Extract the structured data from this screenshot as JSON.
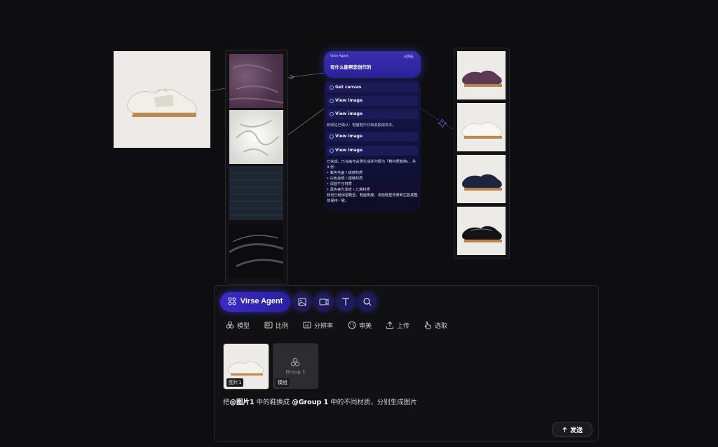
{
  "canvas": {
    "source_image_alt": "white sneaker",
    "material_images": [
      "purple suede",
      "white satin",
      "navy wool",
      "black patent leather"
    ],
    "result_images": [
      "purple sneaker",
      "white sneaker",
      "navy sneaker",
      "black sneaker"
    ]
  },
  "agent_panel": {
    "app_name": "Virse Agent",
    "status": "已完成",
    "question": "有什么能帮您创作的",
    "steps": [
      {
        "label": "Get canvas"
      },
      {
        "label": "View image"
      },
      {
        "label": "View image"
      },
      {
        "label": "View image"
      },
      {
        "label": "View image"
      }
    ],
    "note_1": "新网站已确认：鞋履鞋中仔和素颜成效本。",
    "summary_intro": "已完成，已在画布右侧生成并归组为「鞋材质替换」，共 4 张:",
    "summary_items": [
      "紫色毛面 / 绒感材质",
      "白色丝绸 / 褶皱材质",
      "深蓝牛仔材质",
      "黑色亮光漆皮 / 乙烯材质"
    ],
    "summary_outro": "我也已经保留鞋型、鞋面角度、浅色鞋垫背景和生胶底整体保持一致。"
  },
  "composer": {
    "agent_button": "Virse Agent",
    "options": [
      {
        "icon": "model-icon",
        "label": "模型"
      },
      {
        "icon": "ratio-icon",
        "label": "比例"
      },
      {
        "icon": "hd-icon",
        "label": "分辨率"
      },
      {
        "icon": "palette-icon",
        "label": "审美"
      },
      {
        "icon": "upload-icon",
        "label": "上传"
      },
      {
        "icon": "pointer-icon",
        "label": "选取"
      }
    ],
    "attachment_1_tag": "图片1",
    "attachment_2_name": "Group 1",
    "attachment_2_tag": "模组",
    "prompt_parts": {
      "p1": "把",
      "ref1": "@图片1",
      "p2": " 中的鞋换成 ",
      "ref2": "@Group 1",
      "p3": " 中的不同材质，分别生成图片"
    },
    "send_label": "发送"
  },
  "colors": {
    "accent": "#3b2bc7",
    "background": "#0e0e10"
  }
}
